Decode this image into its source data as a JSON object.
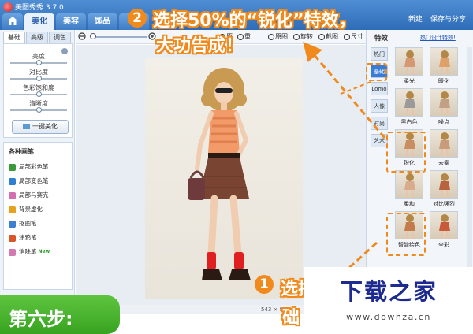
{
  "app": {
    "title": "美图秀秀 3.7.0"
  },
  "tabs": [
    {
      "label": "美化"
    },
    {
      "label": "美容"
    },
    {
      "label": "饰品"
    },
    {
      "label": "文"
    }
  ],
  "window_buttons": {
    "new": "新建",
    "save": "保存与分享"
  },
  "left_panel": {
    "subtabs": [
      "基础",
      "高级",
      "调色"
    ],
    "sliders": [
      {
        "label": "亮度",
        "level": 0.5
      },
      {
        "label": "对比度",
        "level": 0.5
      },
      {
        "label": "色彩饱和度",
        "level": 0.5
      },
      {
        "label": "清晰度",
        "level": 0.5
      }
    ],
    "one_key_button": "一键美化",
    "brush_title": "各种画笔",
    "brushes": [
      {
        "label": "局部彩色笔",
        "icon": "color-brush-icon",
        "color": "#3a9a3a",
        "badge": ""
      },
      {
        "label": "局部变色笔",
        "icon": "recolor-brush-icon",
        "color": "#2f7fd0",
        "badge": ""
      },
      {
        "label": "局部马赛克",
        "icon": "mosaic-icon",
        "color": "#d26fb0",
        "badge": ""
      },
      {
        "label": "背景虚化",
        "icon": "blur-bg-icon",
        "color": "#e6a21c",
        "badge": ""
      },
      {
        "label": "抠图笔",
        "icon": "cutout-pen-icon",
        "color": "#3b7fd0",
        "badge": ""
      },
      {
        "label": "涂鸦笔",
        "icon": "doodle-pen-icon",
        "color": "#d8572a",
        "badge": ""
      },
      {
        "label": "消除笔",
        "icon": "eraser-pen-icon",
        "color": "#d07ab0",
        "badge": "New"
      }
    ]
  },
  "toolbar": {
    "items": [
      "原图",
      "旋转",
      "截图",
      "尺寸"
    ],
    "partial_labels": [
      "原",
      "重"
    ]
  },
  "canvas": {
    "image_size": "543 × 8"
  },
  "right_panel": {
    "title": "特效",
    "link": "热门设计特效!",
    "categories": [
      "热门",
      "基础",
      "Lomo",
      "人像",
      "时尚",
      "艺术"
    ],
    "active_category": "基础",
    "effects": [
      {
        "label": "柔光",
        "tint": "#d49873"
      },
      {
        "label": "暖化",
        "tint": "#e0a06a"
      },
      {
        "label": "黑白色",
        "tint": "#9a9a9a"
      },
      {
        "label": "噪点",
        "tint": "#c2a084"
      },
      {
        "label": "锐化",
        "tint": "#c98d62"
      },
      {
        "label": "去雾",
        "tint": "#c99b7a"
      },
      {
        "label": "柔和",
        "tint": "#d8ab8a"
      },
      {
        "label": "对比强烈",
        "tint": "#b8623e"
      },
      {
        "label": "智能绘色",
        "tint": "#c47a4a"
      },
      {
        "label": "全彩",
        "tint": "#c85a3a"
      }
    ]
  },
  "annotations": {
    "step2_number": "2",
    "step2_line1": "选择50%的“锐化”特效，",
    "step2_line2": "大功告成！",
    "step1_number": "1",
    "step1_line1": "选择",
    "step1_line2": "础"
  },
  "step_banner": "第六步:",
  "watermark": {
    "title": "下载之家",
    "url": "www.downza.cn"
  },
  "colors": {
    "accent_orange": "#f08a1c",
    "titlebar_blue": "#3a7bd5",
    "banner_green": "#4cb52f"
  }
}
